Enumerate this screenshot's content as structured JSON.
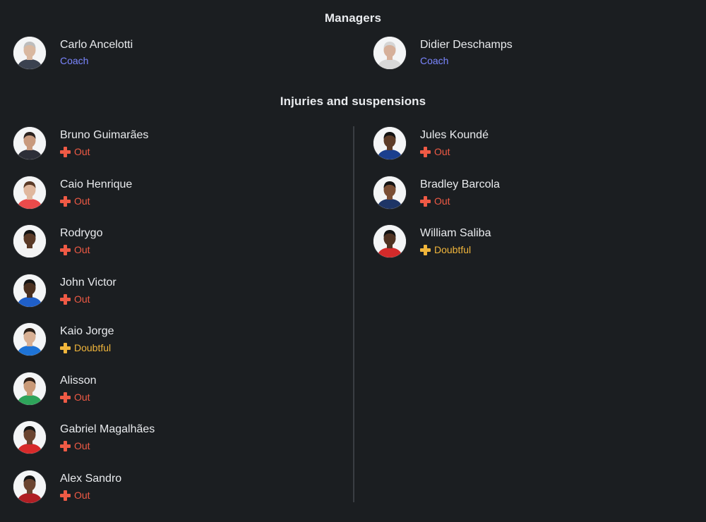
{
  "managers": {
    "title": "Managers",
    "items": [
      {
        "name": "Carlo Ancelotti",
        "role": "Coach",
        "shirt": "#3b4250",
        "skin": "#d9b8a0",
        "hair": "#bdbdbd"
      },
      {
        "name": "Didier Deschamps",
        "role": "Coach",
        "shirt": "#d8d8d8",
        "skin": "#d6b09a",
        "hair": "#d5d5d5"
      }
    ]
  },
  "injuries": {
    "title": "Injuries and suspensions",
    "left": [
      {
        "name": "Bruno Guimarães",
        "status": "Out",
        "kind": "out",
        "shirt": "#2d2f38",
        "skin": "#c89a7e",
        "hair": "#2b2320"
      },
      {
        "name": "Caio Henrique",
        "status": "Out",
        "kind": "out",
        "shirt": "#e94b4b",
        "skin": "#e0b89e",
        "hair": "#5a3a27"
      },
      {
        "name": "Rodrygo",
        "status": "Out",
        "kind": "out",
        "shirt": "#f2f2f2",
        "skin": "#5a3a28",
        "hair": "#141414"
      },
      {
        "name": "John Victor",
        "status": "Out",
        "kind": "out",
        "shirt": "#1f5fc8",
        "skin": "#4a3020",
        "hair": "#141414"
      },
      {
        "name": "Kaio Jorge",
        "status": "Doubtful",
        "kind": "doubtful",
        "shirt": "#1e73d6",
        "skin": "#d8b094",
        "hair": "#2b2018"
      },
      {
        "name": "Alisson",
        "status": "Out",
        "kind": "out",
        "shirt": "#2ea45a",
        "skin": "#c99a78",
        "hair": "#2a1d16"
      },
      {
        "name": "Gabriel Magalhães",
        "status": "Out",
        "kind": "out",
        "shirt": "#d72a2a",
        "skin": "#6a4430",
        "hair": "#151515"
      },
      {
        "name": "Alex Sandro",
        "status": "Out",
        "kind": "out",
        "shirt": "#b01e24",
        "skin": "#6b4430",
        "hair": "#151515"
      }
    ],
    "right": [
      {
        "name": "Jules Koundé",
        "status": "Out",
        "kind": "out",
        "shirt": "#1b3f8e",
        "skin": "#5c3b27",
        "hair": "#121212"
      },
      {
        "name": "Bradley Barcola",
        "status": "Out",
        "kind": "out",
        "shirt": "#1e3566",
        "skin": "#7a4e34",
        "hair": "#121212"
      },
      {
        "name": "William Saliba",
        "status": "Doubtful",
        "kind": "doubtful",
        "shirt": "#d32a2a",
        "skin": "#4f3222",
        "hair": "#121212"
      }
    ]
  }
}
